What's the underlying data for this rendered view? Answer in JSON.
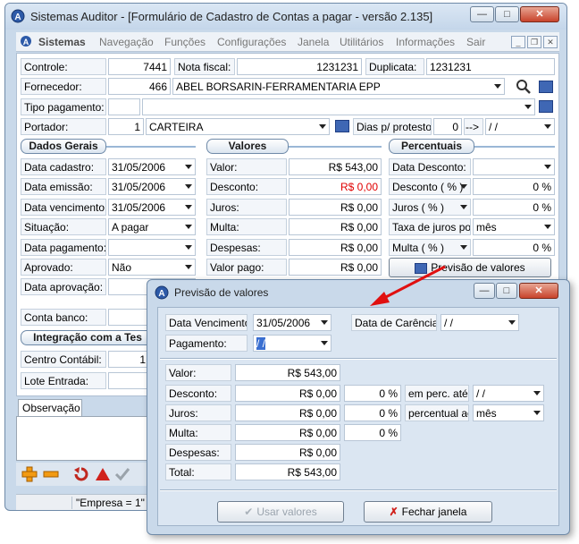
{
  "window": {
    "title": "Sistemas Auditor - [Formulário de Cadastro de Contas a pagar - versão 2.135]"
  },
  "menu": {
    "items": [
      "Sistemas",
      "Navegação",
      "Funções",
      "Configurações",
      "Janela",
      "Utilitários",
      "Informações",
      "Sair"
    ]
  },
  "form": {
    "controle_label": "Controle:",
    "controle_value": "7441",
    "nota_fiscal_label": "Nota fiscal:",
    "nota_fiscal_value": "1231231",
    "duplicata_label": "Duplicata:",
    "duplicata_value": "1231231",
    "fornecedor_label": "Fornecedor:",
    "fornecedor_code": "466",
    "fornecedor_name": "ABEL BORSARIN-FERRAMENTARIA EPP",
    "tipo_pagamento_label": "Tipo pagamento:",
    "portador_label": "Portador:",
    "portador_code": "1",
    "portador_name": "CARTEIRA",
    "dias_protesto_label": "Dias p/ protesto:",
    "dias_protesto_value": "0",
    "arrow_text": "-->",
    "protesto_date": " /  /"
  },
  "dados_gerais": {
    "title": "Dados Gerais",
    "rows": [
      {
        "label": "Data cadastro:",
        "value": "31/05/2006"
      },
      {
        "label": "Data emissão:",
        "value": "31/05/2006"
      },
      {
        "label": "Data vencimento:",
        "value": "31/05/2006"
      },
      {
        "label": "Situação:",
        "value": "A pagar"
      },
      {
        "label": "Data pagamento:",
        "value": ""
      },
      {
        "label": "Aprovado:",
        "value": "Não"
      },
      {
        "label": "Data aprovação:",
        "value": ""
      }
    ],
    "conta_banco_label": "Conta banco:"
  },
  "integracao": {
    "title": "Integração com a Tes",
    "centro_label": "Centro Contábil:",
    "centro_value": "1",
    "lote_label": "Lote Entrada:"
  },
  "valores": {
    "title": "Valores",
    "rows": [
      {
        "label": "Valor:",
        "value": "R$ 543,00"
      },
      {
        "label": "Desconto:",
        "value": "R$ 0,00"
      },
      {
        "label": "Juros:",
        "value": "R$ 0,00"
      },
      {
        "label": "Multa:",
        "value": "R$ 0,00"
      },
      {
        "label": "Despesas:",
        "value": "R$ 0,00"
      },
      {
        "label": "Valor pago:",
        "value": "R$ 0,00"
      }
    ]
  },
  "percentuais": {
    "title": "Percentuais",
    "rows": [
      {
        "label": "Data Desconto:",
        "value": ""
      },
      {
        "label": "Desconto ( % )",
        "value": "0 %"
      },
      {
        "label": "Juros ( % )",
        "value": "0 %"
      },
      {
        "label": "Taxa de juros por:",
        "value": "mês"
      },
      {
        "label": "Multa ( % )",
        "value": "0 %"
      }
    ],
    "previsao_button": "Previsão de valores"
  },
  "lower": {
    "observacao_tab": "Observação"
  },
  "status": {
    "empresa": "\"Empresa = 1\""
  },
  "dialog": {
    "title": "Previsão de valores",
    "data_vencimento_label": "Data Vencimento:",
    "data_vencimento_value": "31/05/2006",
    "data_carencia_label": "Data de Carência:",
    "data_carencia_value": " /  /",
    "pagamento_label": "Pagamento:",
    "pagamento_value": " /  /",
    "valor_label": "Valor:",
    "valor_value": "R$ 543,00",
    "desconto_label": "Desconto:",
    "desconto_value": "R$ 0,00",
    "desconto_pct": "0 %",
    "em_perc_label": "em perc. até",
    "em_perc_value": " /  /",
    "juros_label": "Juros:",
    "juros_value": "R$ 0,00",
    "juros_pct": "0 %",
    "perc_ao_label": "percentual ao",
    "perc_ao_value": "mês",
    "multa_label": "Multa:",
    "multa_value": "R$ 0,00",
    "multa_pct": "0 %",
    "despesas_label": "Despesas:",
    "despesas_value": "R$ 0,00",
    "total_label": "Total:",
    "total_value": "R$ 543,00",
    "usar_button": "Usar valores",
    "fechar_button": "Fechar janela"
  }
}
